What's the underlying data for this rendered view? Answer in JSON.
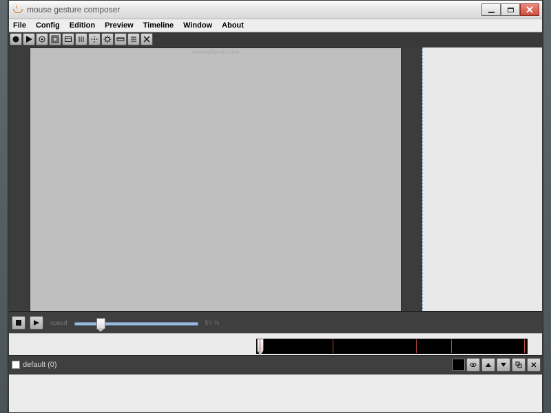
{
  "window": {
    "title": "mouse gesture composer"
  },
  "menu": {
    "items": [
      "File",
      "Config",
      "Edition",
      "Preview",
      "Timeline",
      "Window",
      "About"
    ]
  },
  "toolbar": {
    "buttons": [
      "record",
      "play",
      "target",
      "fullscreen",
      "frame",
      "columns",
      "pan",
      "settings",
      "ruler",
      "list",
      "close"
    ]
  },
  "canvas": {
    "watermark": "www.softpedia.com"
  },
  "speed": {
    "label": "speed",
    "value_text": "50 %",
    "value": 50
  },
  "timeline": {
    "marks_pct": [
      1,
      28,
      59,
      72,
      99
    ]
  },
  "layer": {
    "name": "default (0)",
    "buttons": [
      "color",
      "eye",
      "up",
      "down",
      "dup",
      "close"
    ]
  }
}
